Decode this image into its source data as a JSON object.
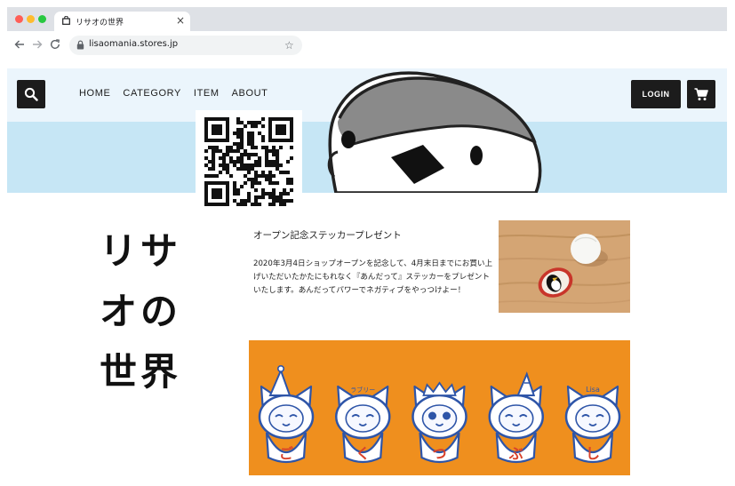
{
  "browser": {
    "tab_title": "リサオの世界",
    "tab_close": "×",
    "url": "lisaomania.stores.jp",
    "star": "☆"
  },
  "header": {
    "nav": [
      "HOME",
      "CATEGORY",
      "ITEM",
      "ABOUT"
    ],
    "login_label": "LOGIN"
  },
  "shop": {
    "title_lines": [
      "リサ",
      "オの",
      "世界"
    ]
  },
  "post": {
    "title": "オープン記念ステッカープレゼント",
    "body": "2020年3月4日ショップオープンを記念して、4月末日までにお買い上げいただいたかたにもれなく『あんだって』ステッカーをプレゼントいたします。あんだってパワーでネガティブをやっつけよー！"
  },
  "banner": {
    "characters": [
      "ご",
      "く",
      "つ",
      "ぶ",
      "し"
    ],
    "annotations": [
      "ラブリー",
      "Lisa"
    ]
  },
  "colors": {
    "hero_sky": "#c6e6f5",
    "hero_top": "#ebf5fc",
    "dark_button": "#1c1c1c",
    "banner_orange": "#ef8f1e",
    "character_blue": "#2e55a8",
    "character_red": "#d8412a"
  }
}
